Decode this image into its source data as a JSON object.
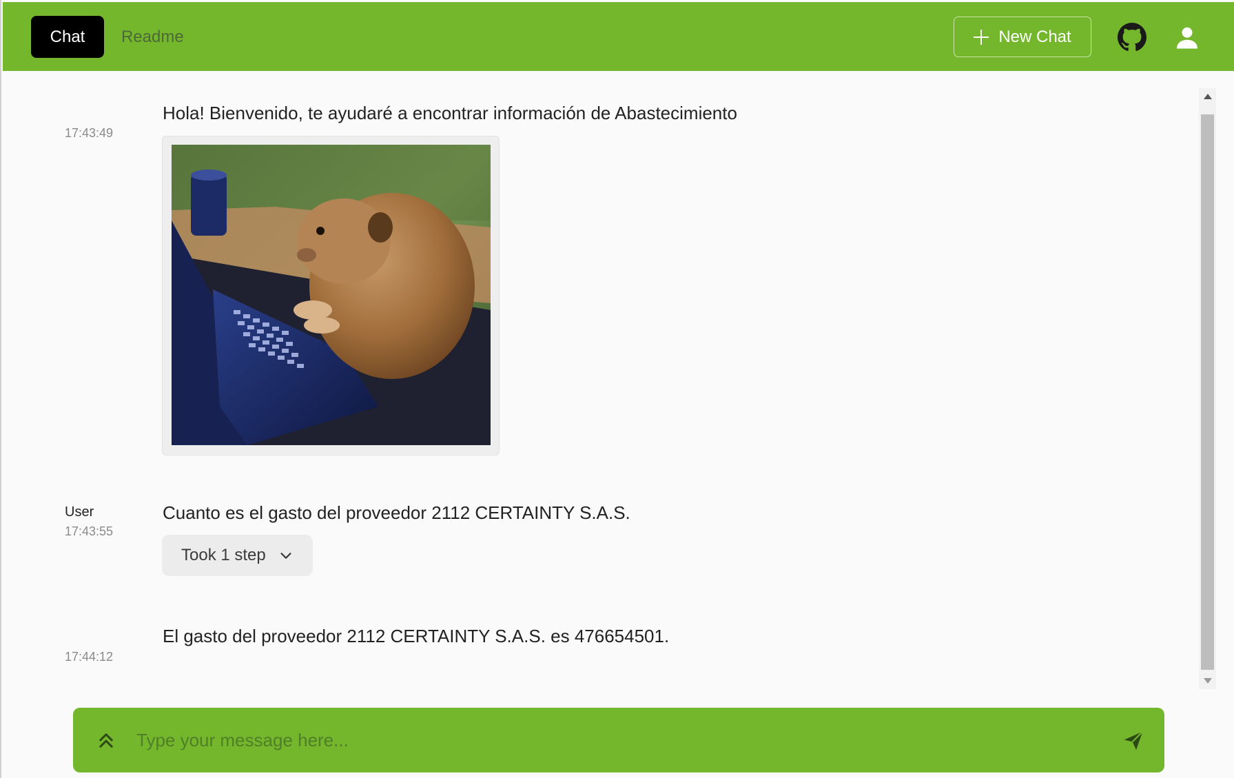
{
  "header": {
    "tabs": [
      {
        "label": "Chat",
        "active": true
      },
      {
        "label": "Readme",
        "active": false
      }
    ],
    "new_chat_label": "New Chat",
    "icons": [
      "plus-icon",
      "github-icon",
      "user-icon"
    ]
  },
  "messages": [
    {
      "author": "",
      "time": "17:43:49",
      "text": "Hola! Bienvenido, te ayudaré a encontrar información de Abastecimiento",
      "image": "capybara-typing-on-laptop"
    },
    {
      "author": "User",
      "time": "17:43:55",
      "text": "Cuanto es el gasto del proveedor 2112 CERTAINTY S.A.S.",
      "steps_label": "Took 1 step"
    },
    {
      "author": "",
      "time": "17:44:12",
      "text": "El gasto del proveedor 2112 CERTAINTY S.A.S. es 476654501."
    }
  ],
  "composer": {
    "placeholder": "Type your message here...",
    "value": ""
  },
  "colors": {
    "brand": "#74b72d",
    "active_tab": "#000000",
    "background": "#fafafa"
  }
}
